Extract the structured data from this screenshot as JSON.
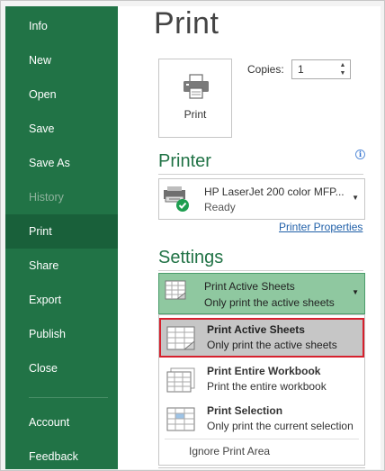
{
  "sidebar": {
    "items": [
      {
        "label": "Info"
      },
      {
        "label": "New"
      },
      {
        "label": "Open"
      },
      {
        "label": "Save"
      },
      {
        "label": "Save As"
      },
      {
        "label": "History",
        "disabled": true
      },
      {
        "label": "Print",
        "active": true
      },
      {
        "label": "Share"
      },
      {
        "label": "Export"
      },
      {
        "label": "Publish"
      },
      {
        "label": "Close"
      },
      {
        "label": "Account"
      },
      {
        "label": "Feedback"
      }
    ],
    "color": "#217346",
    "active_color": "#19603a"
  },
  "main": {
    "title": "Print",
    "print_button": {
      "label": "Print",
      "icon": "printer-icon"
    },
    "copies": {
      "label": "Copies:",
      "value": "1"
    },
    "info_icon": "i",
    "printer": {
      "heading": "Printer",
      "name": "HP LaserJet 200 color MFP...",
      "status": "Ready",
      "properties_link": "Printer Properties"
    },
    "settings": {
      "heading": "Settings",
      "selected": {
        "title": "Print Active Sheets",
        "subtitle": "Only print the active sheets"
      },
      "options": [
        {
          "title": "Print Active Sheets",
          "subtitle": "Only print the active sheets",
          "highlighted": true
        },
        {
          "title": "Print Entire Workbook",
          "subtitle": "Print the entire workbook"
        },
        {
          "title": "Print Selection",
          "subtitle": "Only print the current selection"
        }
      ],
      "ignore_print_area": "Ignore Print Area"
    },
    "accent_color": "#217346",
    "highlight_border_color": "#d6202d"
  }
}
